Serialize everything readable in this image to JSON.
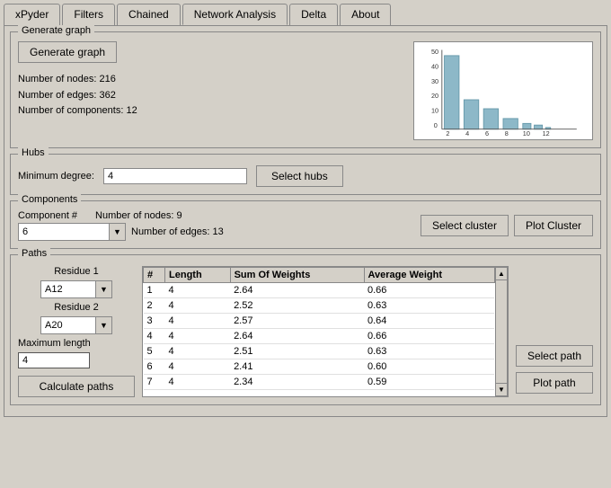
{
  "tabs": [
    {
      "label": "xPyder",
      "active": false
    },
    {
      "label": "Filters",
      "active": false
    },
    {
      "label": "Chained",
      "active": false
    },
    {
      "label": "Network Analysis",
      "active": true
    },
    {
      "label": "Delta",
      "active": false
    },
    {
      "label": "About",
      "active": false
    }
  ],
  "generate_graph": {
    "section_label": "Generate graph",
    "button_label": "Generate graph",
    "stats": {
      "nodes_label": "Number of nodes: 216",
      "edges_label": "Number of edges: 362",
      "components_label": "Number of components: 12"
    },
    "chart": {
      "y_labels": [
        "50",
        "40",
        "30",
        "20",
        "10",
        "0"
      ],
      "x_labels": [
        "2",
        "4",
        "6",
        "8",
        "10",
        "12"
      ]
    }
  },
  "hubs": {
    "section_label": "Hubs",
    "min_degree_label": "Minimum degree:",
    "min_degree_value": "4",
    "button_label": "Select hubs"
  },
  "components": {
    "section_label": "Components",
    "comp_label": "Component #",
    "comp_value": "6",
    "nodes_label": "Number of nodes: 9",
    "edges_label": "Number of edges: 13",
    "select_cluster_label": "Select cluster",
    "plot_cluster_label": "Plot Cluster"
  },
  "paths": {
    "section_label": "Paths",
    "residue1_label": "Residue 1",
    "residue1_value": "A12",
    "residue2_label": "Residue 2",
    "residue2_value": "A20",
    "max_length_label": "Maximum length",
    "max_length_value": "4",
    "calculate_btn_label": "Calculate paths",
    "select_path_btn_label": "Select path",
    "plot_path_btn_label": "Plot path",
    "table_headers": [
      "#",
      "Length",
      "Sum Of Weights",
      "Average Weight"
    ],
    "table_rows": [
      {
        "num": "1",
        "length": "4",
        "sum": "2.64",
        "avg": "0.66"
      },
      {
        "num": "2",
        "length": "4",
        "sum": "2.52",
        "avg": "0.63"
      },
      {
        "num": "3",
        "length": "4",
        "sum": "2.57",
        "avg": "0.64"
      },
      {
        "num": "4",
        "length": "4",
        "sum": "2.64",
        "avg": "0.66"
      },
      {
        "num": "5",
        "length": "4",
        "sum": "2.51",
        "avg": "0.63"
      },
      {
        "num": "6",
        "length": "4",
        "sum": "2.41",
        "avg": "0.60"
      },
      {
        "num": "7",
        "length": "4",
        "sum": "2.34",
        "avg": "0.59"
      }
    ]
  }
}
